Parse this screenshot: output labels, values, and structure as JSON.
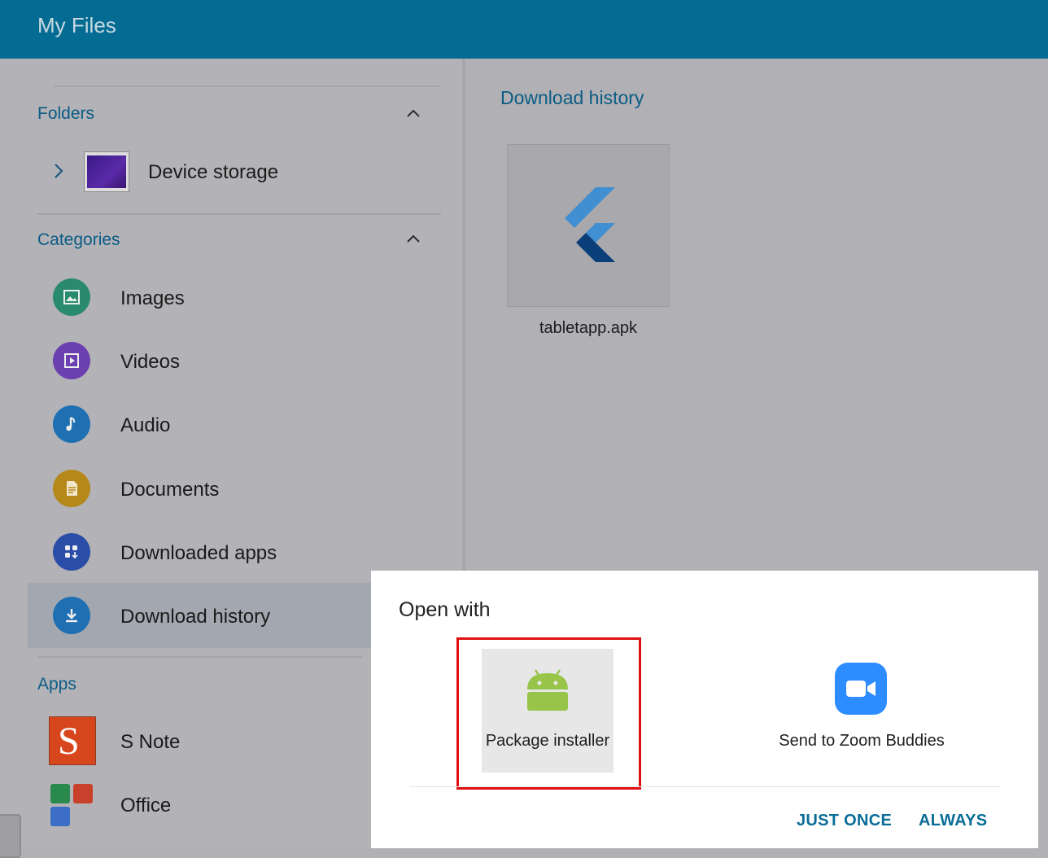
{
  "app": {
    "title": "My Files"
  },
  "sidebar": {
    "folders_title": "Folders",
    "device_storage": "Device storage",
    "categories_title": "Categories",
    "categories": [
      {
        "label": "Images",
        "icon": "image-icon",
        "color": "#2a8a6e"
      },
      {
        "label": "Videos",
        "icon": "video-icon",
        "color": "#6b3fb0"
      },
      {
        "label": "Audio",
        "icon": "music-note-icon",
        "color": "#1f6fb3"
      },
      {
        "label": "Documents",
        "icon": "document-icon",
        "color": "#b5881a"
      },
      {
        "label": "Downloaded apps",
        "icon": "apps-download-icon",
        "color": "#2a4ea8"
      },
      {
        "label": "Download history",
        "icon": "download-icon",
        "color": "#1f6fb3",
        "selected": true
      }
    ],
    "apps_title": "Apps",
    "apps": [
      {
        "label": "S Note",
        "icon": "s-note-icon"
      },
      {
        "label": "Office",
        "icon": "office-icon"
      }
    ]
  },
  "main": {
    "title": "Download history",
    "file": {
      "name": "tabletapp.apk",
      "icon": "flutter-icon"
    }
  },
  "dialog": {
    "title": "Open with",
    "options": [
      {
        "label": "Package installer",
        "icon": "android-icon",
        "highlighted": true
      },
      {
        "label": "Send to Zoom Buddies",
        "icon": "zoom-icon"
      }
    ],
    "just_once": "JUST ONCE",
    "always": "ALWAYS"
  },
  "colors": {
    "appbar": "#046c92",
    "accent_text": "#0a5c86",
    "highlight_border": "#e01010",
    "dialog_button": "#0a6d98"
  }
}
